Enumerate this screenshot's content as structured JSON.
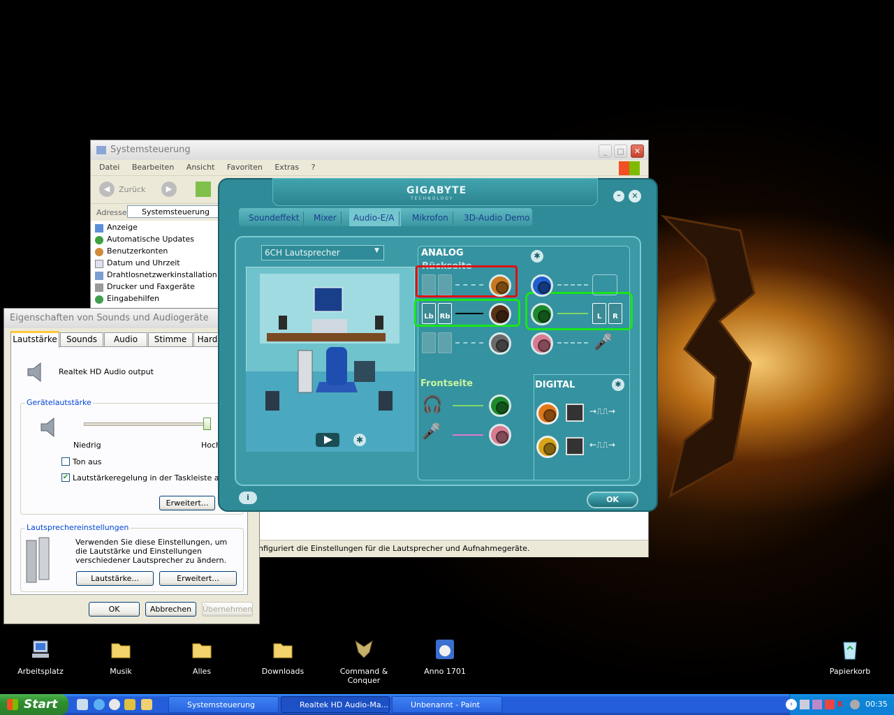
{
  "syscontrol": {
    "title": "Systemsteuerung",
    "menu": [
      "Datei",
      "Bearbeiten",
      "Ansicht",
      "Favoriten",
      "Extras",
      "?"
    ],
    "back_label": "Zurück",
    "address_label": "Adresse",
    "address_value": "Systemsteuerung",
    "items": [
      "Anzeige",
      "Automatische Updates",
      "Benutzerkonten",
      "Datum und Uhrzeit",
      "Drahtlosnetzwerkinstallation",
      "Drucker und Faxgeräte",
      "Eingabehilfen"
    ],
    "status_text": "nfiguriert die Einstellungen für die Lautsprecher und Aufnahmegeräte."
  },
  "sounddlg": {
    "title": "Eigenschaften von Sounds und Audiogeräte",
    "tabs": [
      "Lautstärke",
      "Sounds",
      "Audio",
      "Stimme",
      "Hard"
    ],
    "device_name": "Realtek HD Audio output",
    "volume_group": "Gerätelautstärke",
    "volume_low": "Niedrig",
    "volume_high": "Hoch",
    "volume_level": 0.98,
    "mute_label": "Ton aus",
    "mute_checked": false,
    "taskbar_vol_label": "Lautstärkeregelung in der Taskleiste anzeigen",
    "taskbar_vol_checked": true,
    "advanced_label": "Erweitert...",
    "speaker_group": "Lautsprechereinstellungen",
    "speaker_desc": "Verwenden Sie diese Einstellungen, um die Lautstärke und Einstellungen verschiedener Lautsprecher zu ändern.",
    "speaker_volume_btn": "Lautstärke...",
    "speaker_advanced_btn": "Erweitert...",
    "ok": "OK",
    "cancel": "Abbrechen",
    "apply": "Übernehmen"
  },
  "realtek": {
    "brand": "GIGABYTE",
    "brand_sub": "TECHNOLOGY",
    "tabs": [
      "Soundeffekt",
      "Mixer",
      "Audio-E/A",
      "Mikrofon",
      "3D-Audio Demo"
    ],
    "speaker_config": "6CH Lautsprecher",
    "analog_label": "ANALOG",
    "rear_label": "Rückseite",
    "front_label": "Frontseite",
    "digital_label": "DIGITAL",
    "speaker_lb": "Lb",
    "speaker_rb": "Rb",
    "speaker_l": "L",
    "speaker_r": "R",
    "ok": "OK",
    "colors": {
      "panel": "#2f8b97",
      "highlight_red": "#e01010",
      "highlight_green": "#19e619"
    }
  },
  "desktop_icons": [
    {
      "label": "Arbeitsplatz",
      "icon": "computer-icon"
    },
    {
      "label": "Musik",
      "icon": "folder-icon"
    },
    {
      "label": "Alles",
      "icon": "folder-icon"
    },
    {
      "label": "Downloads",
      "icon": "folder-icon"
    },
    {
      "label": "Command & Conquer",
      "icon": "cnc-icon"
    },
    {
      "label": "Anno 1701",
      "icon": "anno-icon"
    },
    {
      "label": "Papierkorb",
      "icon": "recycle-bin-icon"
    }
  ],
  "taskbar": {
    "start": "Start",
    "items": [
      "Systemsteuerung",
      "Realtek HD Audio-Ma...",
      "Unbenannt - Paint"
    ],
    "clock": "00:35"
  }
}
